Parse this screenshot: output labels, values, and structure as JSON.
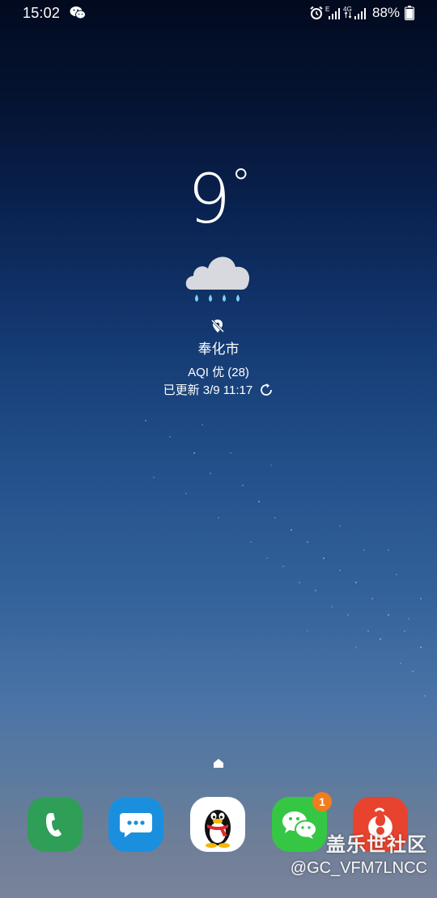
{
  "status_bar": {
    "time": "15:02",
    "notification_icons": [
      "wechat-icon"
    ],
    "indicator_icons": [
      "alarm-icon",
      "signal-e-icon",
      "signal-4g-icon"
    ],
    "signal_1_label": "E",
    "signal_2_label": "4G",
    "battery_percent": "88%"
  },
  "weather": {
    "temperature": "9",
    "degree_symbol": "°",
    "condition_icon": "rain-cloud-icon",
    "location_icon": "location-off-icon",
    "city": "奉化市",
    "aqi": "AQI 优 (28)",
    "updated": "已更新 3/9 11:17",
    "refresh_icon": "refresh-icon"
  },
  "dock": {
    "apps": [
      {
        "name": "Phone",
        "icon": "phone-icon",
        "color": "#2f9e57"
      },
      {
        "name": "Messages",
        "icon": "message-icon",
        "color": "#1a8fde"
      },
      {
        "name": "QQ",
        "icon": "qq-penguin-icon",
        "color": "#ffffff"
      },
      {
        "name": "WeChat",
        "icon": "wechat-icon",
        "color": "#35c743",
        "badge": "1"
      },
      {
        "name": "UC Browser",
        "icon": "uc-browser-icon",
        "color": "#e8432e"
      }
    ]
  },
  "watermark": {
    "title": "盖乐世社区",
    "handle": "@GC_VFM7LNCC"
  }
}
